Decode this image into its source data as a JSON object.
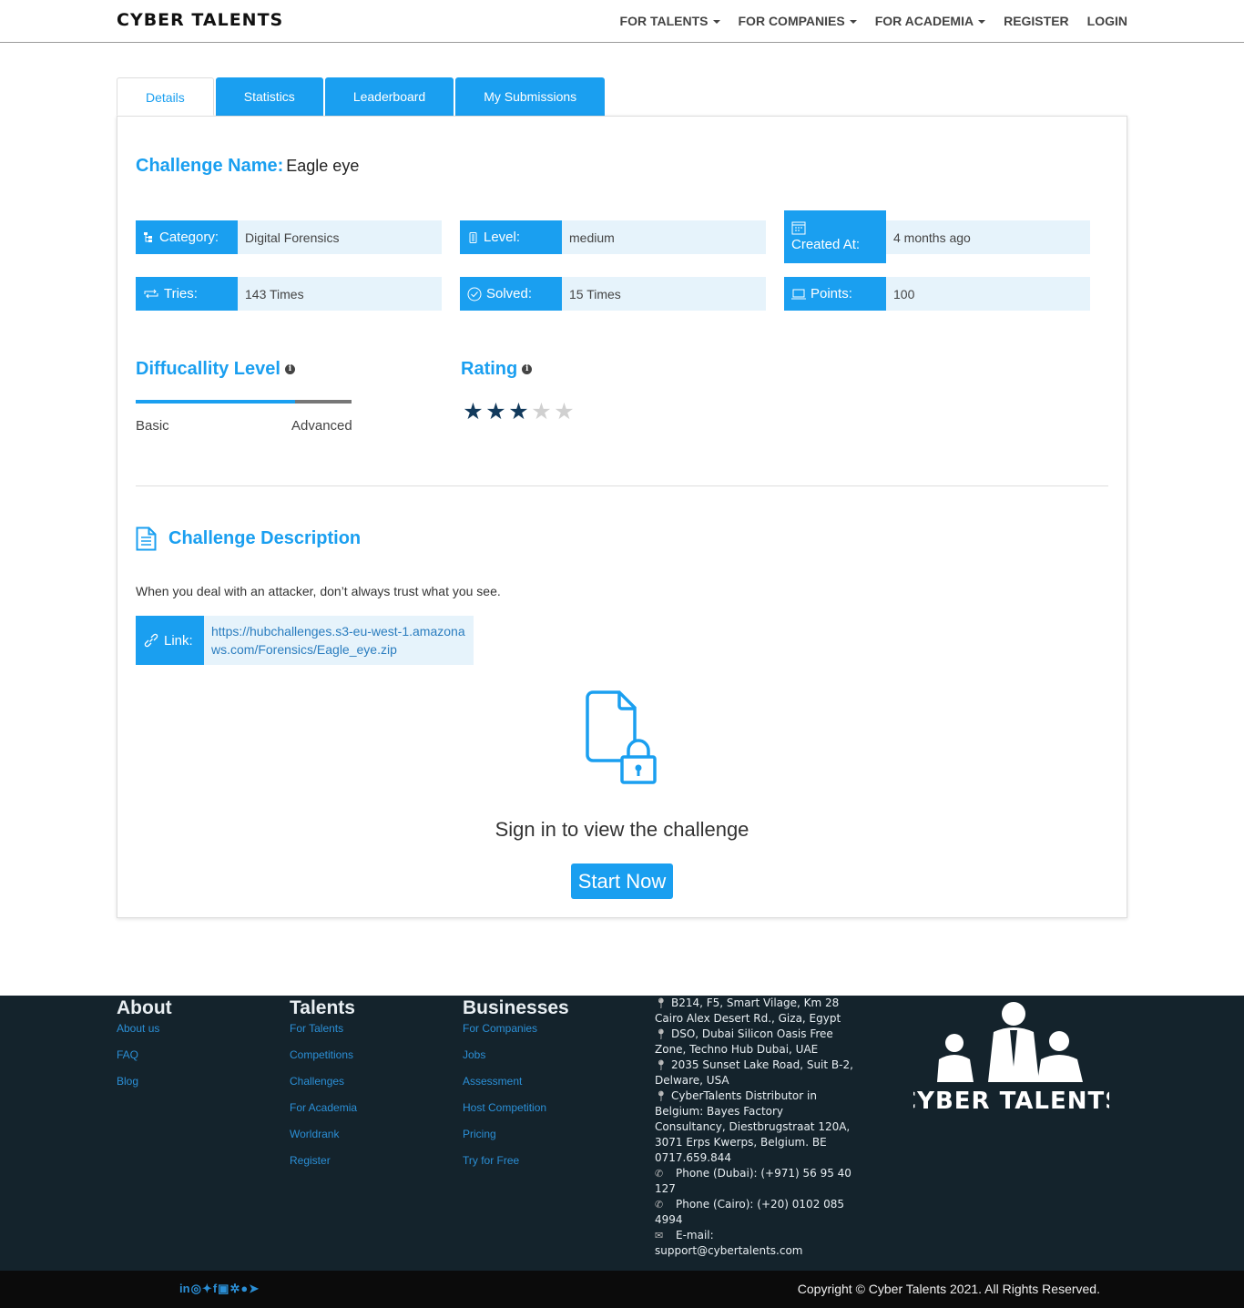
{
  "brand": "CYBER TALENTS",
  "nav": {
    "for_talents": "FOR TALENTS",
    "for_companies": "FOR COMPANIES",
    "for_academia": "FOR ACADEMIA",
    "register": "REGISTER",
    "login": "LOGIN"
  },
  "tabs": [
    "Details",
    "Statistics",
    "Leaderboard",
    "My Submissions"
  ],
  "challenge": {
    "name_label": "Challenge Name:",
    "name": "Eagle eye",
    "category_label": "Category:",
    "category": "Digital Forensics",
    "level_label": "Level:",
    "level": "medium",
    "created_label": "Created At:",
    "created": "4 months ago",
    "tries_label": "Tries:",
    "tries": "143 Times",
    "solved_label": "Solved:",
    "solved": "15 Times",
    "points_label": "Points:",
    "points": "100"
  },
  "difficulty": {
    "title": "Diffucallity Level",
    "min_label": "Basic",
    "max_label": "Advanced",
    "fraction": 0.74
  },
  "rating": {
    "title": "Rating",
    "stars": 3,
    "max": 5
  },
  "description": {
    "title": "Challenge Description",
    "text": "When you deal with an attacker, don’t always trust what you see.",
    "link_label": "Link:",
    "link": "https://hubchallenges.s3-eu-west-1.amazonaws.com/Forensics/Eagle_eye.zip"
  },
  "signin": {
    "text": "Sign in to view the challenge",
    "button": "Start Now"
  },
  "footer": {
    "about": {
      "title": "About",
      "links": [
        "About us",
        "FAQ",
        "Blog"
      ]
    },
    "talents": {
      "title": "Talents",
      "links": [
        "For Talents",
        "Competitions",
        "Challenges",
        "For Academia",
        "Worldrank",
        "Register"
      ]
    },
    "businesses": {
      "title": "Businesses",
      "links": [
        "For Companies",
        "Jobs",
        "Assessment",
        "Host Competition",
        "Pricing",
        "Try for Free"
      ]
    },
    "address": [
      "B214, F5, Smart Vilage, Km 28 Cairo Alex Desert Rd., Giza, Egypt",
      "DSO, Dubai Silicon Oasis Free Zone, Techno Hub Dubai, UAE",
      "2035 Sunset Lake Road, Suit B-2, Delware, USA",
      "CyberTalents Distributor in Belgium: Bayes Factory Consultancy, Diestbrugstraat 120A, 3071 Erps Kwerps, Belgium. BE 0717.659.844"
    ],
    "phone_dubai": "Phone (Dubai): (+971) 56 95 40 127",
    "phone_cairo": "Phone (Cairo): (+20) 0102 085 4994",
    "email": "E-mail: support@cybertalents.com",
    "logo_text": "CYBER TALENTS",
    "copyright": "Copyright © Cyber Talents 2021. All Rights Reserved."
  },
  "colors": {
    "accent": "#1a9ff0",
    "footer_bg": "#14232c",
    "star_on": "#123a5c",
    "star_off": "#d0d0d0"
  }
}
